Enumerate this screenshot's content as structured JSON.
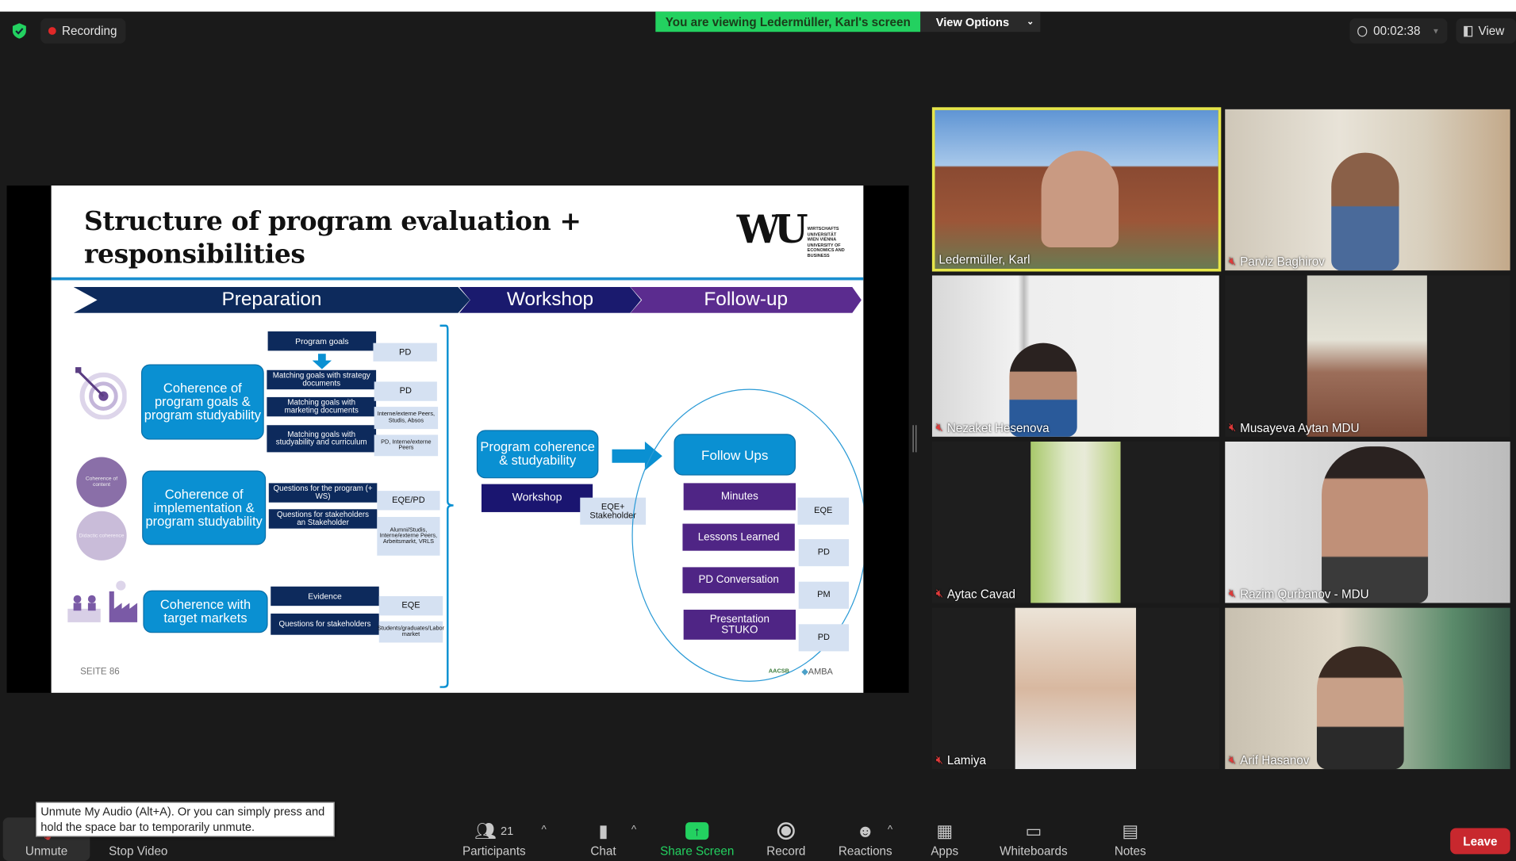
{
  "top_bar": {
    "recording_label": "Recording",
    "banner_text": "You are viewing Ledermüller, Karl's screen",
    "view_options_label": "View Options",
    "timer": "00:02:38",
    "view_label": "View",
    "security_icon": "shield-check-icon",
    "colors": {
      "banner": "#23d160",
      "recording_dot": "#e02828"
    }
  },
  "slide": {
    "title_line1": "Structure of program evaluation +",
    "title_line2": "responsibilities",
    "logo": {
      "mark": "WU",
      "text": "WIRTSCHAFTS UNIVERSITÄT WIEN VIENNA UNIVERSITY OF ECONOMICS AND BUSINESS"
    },
    "phases": [
      "Preparation",
      "Workshop",
      "Follow-up"
    ],
    "coherence_boxes": [
      "Coherence of program goals & program studyability",
      "Coherence of implementation & program studyability",
      "Coherence with target markets"
    ],
    "circles": [
      "Coherence of content",
      "Didactic coherence"
    ],
    "tasks": [
      "Program goals",
      "Matching goals with strategy documents",
      "Matching goals with marketing documents",
      "Matching goals with studyability and curriculum",
      "Questions for the program (+ WS)",
      "Questions for stakeholders an Stakeholder",
      "Evidence",
      "Questions for stakeholders"
    ],
    "responsibles": [
      "PD",
      "PD",
      "Interne/externe Peers, Studis, Absos",
      "PD, Interne/externe Peers",
      "EQE/PD",
      "Alumni/Studis, Interne/externe Peers, Arbeitsmarkt, VRLS",
      "EQE",
      "Students/graduates/Labor market"
    ],
    "workshop": {
      "box": "Program coherence & studyability",
      "label": "Workshop",
      "responsible": "EQE+ Stakeholder"
    },
    "followup": {
      "box": "Follow Ups",
      "items": [
        {
          "label": "Minutes",
          "responsible": "EQE"
        },
        {
          "label": "Lessons Learned",
          "responsible": "PD"
        },
        {
          "label": "PD Conversation",
          "responsible": "PM"
        },
        {
          "label": "Presentation STUKO",
          "responsible": "PD"
        }
      ]
    },
    "page_label": "SEITE 86",
    "accreditation_logos": [
      "AACSB",
      "AMBA"
    ],
    "colors": {
      "navy": "#0d2a5c",
      "blue": "#0a90d2",
      "purple": "#4f2585",
      "light": "#d5e1f2"
    }
  },
  "participants_tiles": [
    {
      "name": "Ledermüller, Karl",
      "muted": false,
      "active": true
    },
    {
      "name": "Parviz Baghirov",
      "muted": true
    },
    {
      "name": "Nezaket Hesenova",
      "muted": true
    },
    {
      "name": "Musayeva Aytan MDU",
      "muted": true
    },
    {
      "name": "Aytac Cavad",
      "muted": true
    },
    {
      "name": "Razim Qurbanov - MDU",
      "muted": true
    },
    {
      "name": "Lamiya",
      "muted": true
    },
    {
      "name": "Arif Hasanov",
      "muted": true
    }
  ],
  "toolbar": {
    "tooltip": "Unmute My Audio (Alt+A). Or you can simply press and hold the space bar to temporarily unmute.",
    "unmute": "Unmute",
    "stop_video": "Stop Video",
    "participants": "Participants",
    "participants_count": "21",
    "chat": "Chat",
    "share_screen": "Share Screen",
    "record": "Record",
    "reactions": "Reactions",
    "apps": "Apps",
    "whiteboards": "Whiteboards",
    "notes": "Notes",
    "leave": "Leave",
    "colors": {
      "share": "#23d160",
      "leave": "#c8282e"
    }
  }
}
